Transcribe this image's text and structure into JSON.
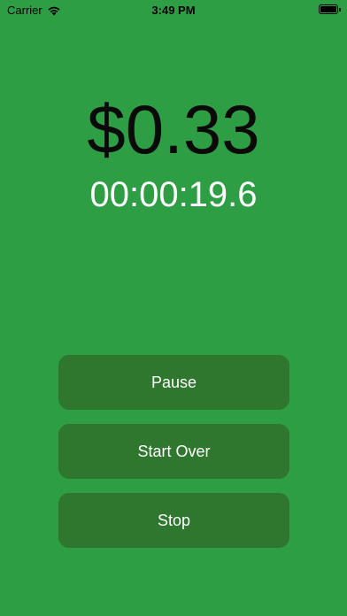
{
  "status_bar": {
    "carrier": "Carrier",
    "time": "3:49 PM"
  },
  "meter": {
    "amount": "$0.33",
    "elapsed": "00:00:19.6"
  },
  "buttons": {
    "pause": "Pause",
    "start_over": "Start Over",
    "stop": "Stop"
  },
  "colors": {
    "background": "#2e9e44",
    "button": "#2f772f",
    "amount_text": "#0a0a0a",
    "timer_text": "#ffffff"
  }
}
